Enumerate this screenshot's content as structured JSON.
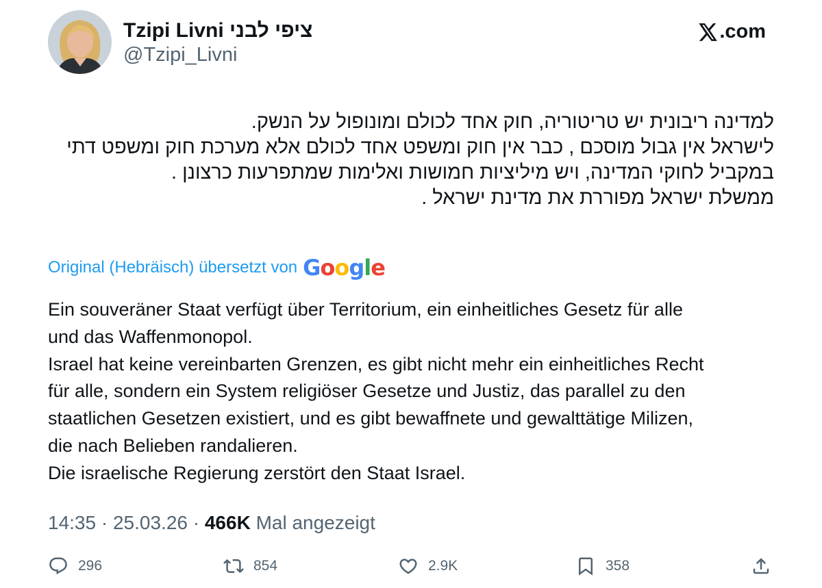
{
  "author": {
    "display_name": "Tzipi Livni ציפי לבני",
    "handle": "@Tzipi_Livni",
    "avatar_icon": "profile-photo"
  },
  "site": {
    "label": ".com",
    "logo_icon": "x-logo-icon"
  },
  "tweet": {
    "original_lines": [
      "למדינה ריבונית יש טריטוריה, חוק אחד לכולם ומונופול על הנשק.",
      "לישראל אין גבול מוסכם , כבר אין חוק ומשפט אחד לכולם אלא מערכת חוק ומשפט דתי",
      "במקביל לחוקי המדינה, ויש מיליציות חמושות ואלימות שמתפרעות כרצונן .",
      "ממשלת ישראל מפוררת את מדינת ישראל ."
    ],
    "translation_notice": "Original (Hebräisch) übersetzt von",
    "translation_provider": "Google",
    "translated_lines": [
      "Ein souveräner Staat verfügt über Territorium, ein einheitliches Gesetz für alle",
      "und das Waffenmonopol.",
      "Israel hat keine vereinbarten Grenzen, es gibt nicht mehr ein einheitliches Recht",
      "für alle, sondern ein System religiöser Gesetze und Justiz, das parallel zu den",
      "staatlichen Gesetzen existiert, und es gibt bewaffnete und gewalttätige Milizen,",
      "die nach Belieben randalieren.",
      "Die israelische Regierung zerstört den Staat Israel."
    ]
  },
  "meta": {
    "time": "14:35",
    "separator": "·",
    "date": "25.03.26",
    "views": "466K",
    "views_label": "Mal angezeigt"
  },
  "actions": {
    "replies": "296",
    "reposts": "854",
    "likes": "2.9K",
    "bookmarks": "358"
  },
  "colors": {
    "link_blue": "#1d9bf0",
    "text_primary": "#0f1419",
    "text_secondary": "#536471",
    "google_blue": "#4285F4",
    "google_red": "#EA4335",
    "google_yellow": "#FBBC05",
    "google_green": "#34A853"
  }
}
